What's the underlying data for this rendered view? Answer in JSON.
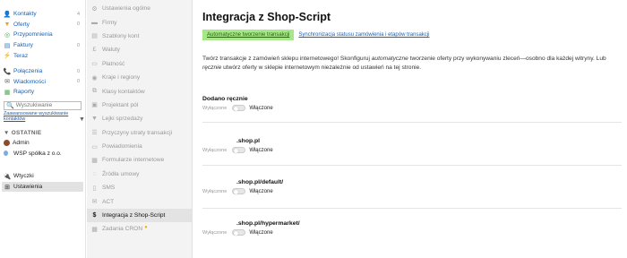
{
  "nav": {
    "items": [
      {
        "label": "Kontakty",
        "count": "4",
        "icon": "contacts-icon",
        "glyph": "👤",
        "color": "#3a78c9"
      },
      {
        "label": "Oferty",
        "count": "0",
        "icon": "offers-icon",
        "glyph": "▼",
        "color": "#f29a1d"
      },
      {
        "label": "Przypomnienia",
        "count": "",
        "icon": "reminders-icon",
        "glyph": "◎",
        "color": "#4aa84a"
      },
      {
        "label": "Faktury",
        "count": "0",
        "icon": "invoices-icon",
        "glyph": "▤",
        "color": "#3a78c9"
      },
      {
        "label": "Teraz",
        "count": "",
        "icon": "bolt-icon",
        "glyph": "⚡",
        "color": "#f2b600"
      }
    ],
    "items2": [
      {
        "label": "Połączenia",
        "count": "0",
        "icon": "calls-icon",
        "glyph": "📞",
        "color": "#333"
      },
      {
        "label": "Wiadomości",
        "count": "0",
        "icon": "messages-icon",
        "glyph": "✉",
        "color": "#555"
      },
      {
        "label": "Raporty",
        "count": "",
        "icon": "reports-icon",
        "glyph": "▦",
        "color": "#4aa84a"
      }
    ],
    "search_placeholder": "Wyszukiwanie",
    "advanced_search": "Zaawansowane wyszukiwanie kontaktów",
    "recent_header": "▼ OSTATNIE",
    "recent": [
      {
        "label": "Admin",
        "icon": "avatar"
      },
      {
        "label": "WSP spółka z o.o.",
        "icon": "company-icon"
      }
    ],
    "plugins": "Wtyczki",
    "settings": "Ustawienia"
  },
  "settings_menu": [
    {
      "label": "Ustawienia ogólne",
      "icon": "gear-icon",
      "glyph": "⚙"
    },
    {
      "label": "Firmy",
      "icon": "companies-icon",
      "glyph": "▬"
    },
    {
      "label": "Szablony kont",
      "icon": "templates-icon",
      "glyph": "▤"
    },
    {
      "label": "Waluty",
      "icon": "currency-icon",
      "glyph": "£"
    },
    {
      "label": "Płatność",
      "icon": "payment-icon",
      "glyph": "▭"
    },
    {
      "label": "Kraje i regiony",
      "icon": "globe-icon",
      "glyph": "◉"
    },
    {
      "label": "Klasy kontaktów",
      "icon": "classes-icon",
      "glyph": "⧉"
    },
    {
      "label": "Projektant pól",
      "icon": "fields-icon",
      "glyph": "▣"
    },
    {
      "label": "Lejki sprzedaży",
      "icon": "funnel-icon",
      "glyph": "▼"
    },
    {
      "label": "Przyczyny utraty transakcji",
      "icon": "list-icon",
      "glyph": "☰"
    },
    {
      "label": "Powiadomienia",
      "icon": "notifications-icon",
      "glyph": "▭"
    },
    {
      "label": "Formularze internetowe",
      "icon": "forms-icon",
      "glyph": "▦"
    },
    {
      "label": "Źródła umowy",
      "icon": "sources-icon",
      "glyph": "◌"
    },
    {
      "label": "SMS",
      "icon": "sms-icon",
      "glyph": "▯"
    },
    {
      "label": "ACT",
      "icon": "act-icon",
      "glyph": "✉"
    },
    {
      "label": "Integracja z Shop-Script",
      "icon": "dollar-icon",
      "glyph": "$"
    },
    {
      "label": "Zadania CRON",
      "icon": "cron-icon",
      "glyph": "▦",
      "badge": "●"
    }
  ],
  "main": {
    "title": "Integracja z Shop-Script",
    "tabs": [
      "Automatyczne tworzenie transakcji",
      "Synchronizacja statusu zamówienia i etapów transakcji"
    ],
    "desc_1": "Twórz transakcje z zamówień sklepu internetowego! Skonfiguruj ",
    "desc_em1": "automatyczne",
    "desc_2": " tworzenie oferty przy wykonywaniu zleceń—osobno dla każdej witryny. Lub ",
    "desc_em2": "ręcznie",
    "desc_3": " utwórz oferty w sklepie internetowym niezależnie od ustawień na tej stronie.",
    "groups": [
      {
        "title": "Dodano ręcznie",
        "off": "Wyłączone",
        "on": "Włączone"
      },
      {
        "title": ".shop.pl",
        "off": "Wyłączone",
        "on": "Włączone"
      },
      {
        "title": ".shop.pl/default/",
        "off": "Wyłączone",
        "on": "Włączone"
      },
      {
        "title": ".shop.pl/hypermarket/",
        "off": "Wyłączone",
        "on": "Włączone"
      }
    ]
  }
}
